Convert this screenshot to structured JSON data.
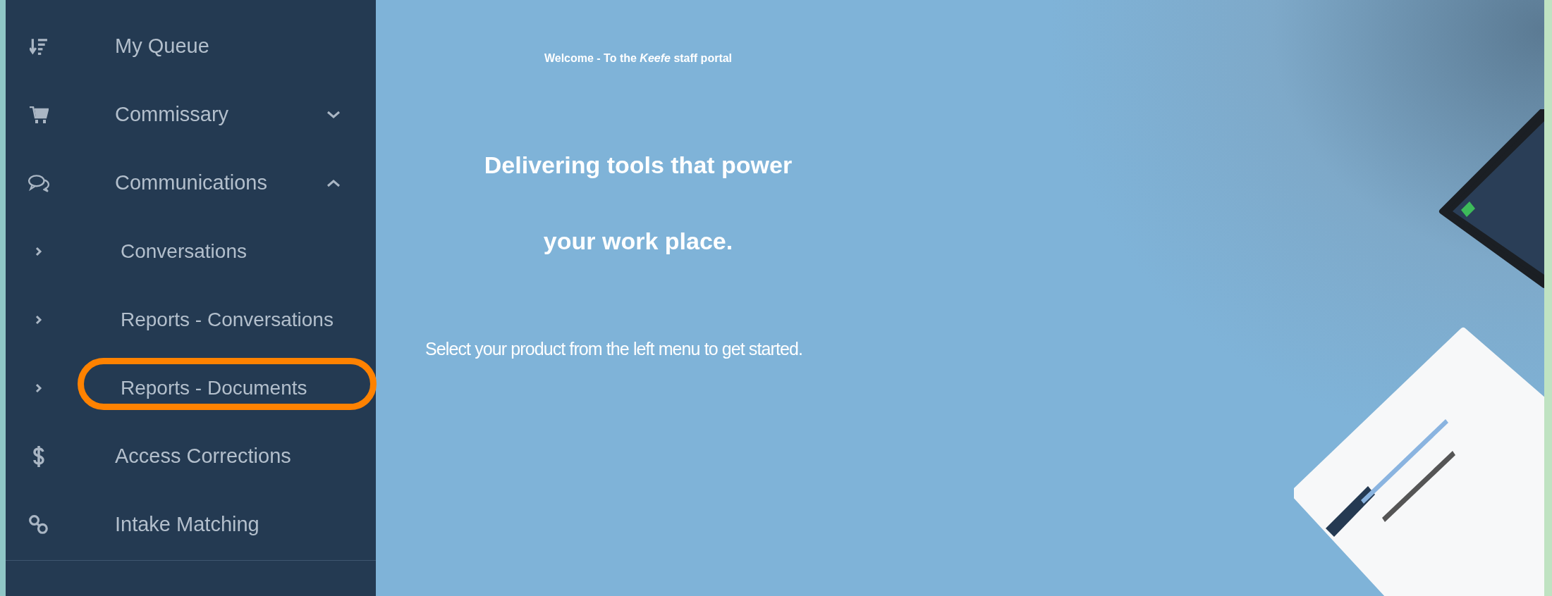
{
  "sidebar": {
    "items": [
      {
        "label": "My Queue",
        "kind": "link"
      },
      {
        "label": "Commissary",
        "kind": "group",
        "expanded": false
      },
      {
        "label": "Communications",
        "kind": "group",
        "expanded": true,
        "children": [
          {
            "label": "Conversations",
            "highlighted": false
          },
          {
            "label": "Reports - Conversations",
            "highlighted": false
          },
          {
            "label": "Reports - Documents",
            "highlighted": true
          }
        ]
      },
      {
        "label": "Access Corrections",
        "kind": "link"
      },
      {
        "label": "Intake Matching",
        "kind": "link"
      }
    ]
  },
  "main": {
    "welcome": "Welcome - To the *Keefe* staff portal",
    "headline": [
      "Delivering tools that power",
      "your work place."
    ],
    "instruction": "Select your product from the left menu to get started."
  }
}
